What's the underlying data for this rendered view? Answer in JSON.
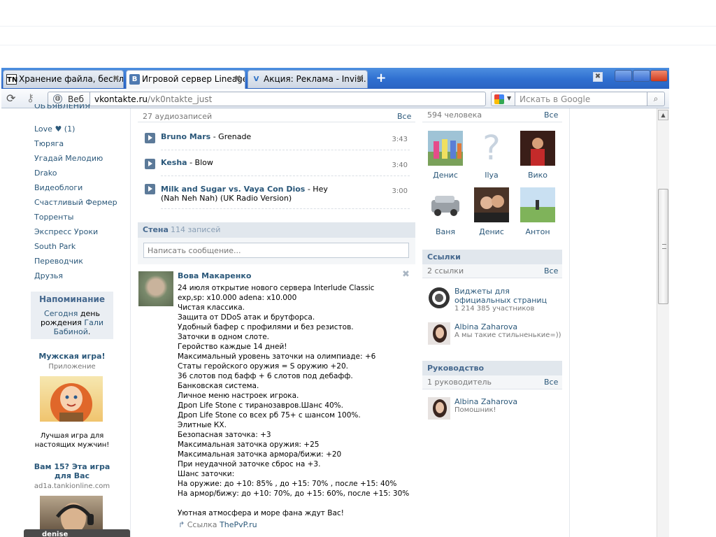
{
  "browser": {
    "tabs": [
      {
        "label": "Хранение файла, беспл...",
        "favicon": "TN"
      },
      {
        "label": "Игровой сервер Lineage...",
        "favicon": "B"
      },
      {
        "label": "Акция: Реклама - Invisi...",
        "favicon": "V"
      }
    ],
    "identity_label": "Веб",
    "url_host": "vkontakte.ru",
    "url_path": "/vk0ntakte_just",
    "search_placeholder": "Искать в Google",
    "icons": {
      "reload": "reload-icon",
      "key": "key-icon",
      "globe": "globe-icon",
      "search": "magnifier-icon",
      "new_tab": "plus-icon"
    }
  },
  "left_menu": {
    "partial_top": "ОБЪЯВЛЕНИЯ",
    "items": [
      "Love ♥ (1)",
      "Тюряга",
      "Угадай Мелодию",
      "Drako",
      "Видеоблоги",
      "Счастливый Фермер",
      "Торренты",
      "Экспресс Уроки",
      "South Park",
      "Переводчик",
      "Друзья"
    ]
  },
  "reminder": {
    "title": "Напоминание",
    "today": "Сегодня",
    "text": "день рождения",
    "name": "Гали Бабиной",
    "dot": "."
  },
  "ads": [
    {
      "title": "Мужская игра!",
      "sub": "Приложение",
      "text": "Лучшая игра для настоящих мужчин!"
    },
    {
      "title": "Вам 15? Эта игра для Вас",
      "sub": "ad1a.tankionline.com"
    }
  ],
  "tooltip_text": "denise",
  "audio": {
    "count": "27 аудиозаписей",
    "all": "Все",
    "tracks": [
      {
        "artist": "Bruno Mars",
        "title": " - Grenade",
        "duration": "3:43"
      },
      {
        "artist": "Kesha",
        "title": " - Blow",
        "duration": "3:40"
      },
      {
        "artist": "Milk and Sugar vs. Vaya Con Dios",
        "title": " - Hey (Nah Neh Nah) (UK Radio Version)",
        "duration": "3:00"
      }
    ]
  },
  "wall": {
    "title": "Стена",
    "count": "114 записей",
    "input_placeholder": "Написать сообщение...",
    "post": {
      "author": "Вова Макаренко",
      "lines": [
        "24 июля открытие нового сервера Interlude Classic",
        "exp,sp: x10.000 adena: x10.000",
        "Чистая классика.",
        "Защита от DDoS атак и брутфорса.",
        "Удобный бафер с профилями и без резистов.",
        "Заточки в одном слоте.",
        "Геройство каждые 14 дней!",
        "Максимальный уровень заточки на олимпиаде: +6",
        "Статы геройского оружия = S оружию +20.",
        "36 слотов под бафф + 6 слотов под дебафф.",
        "Банковская система.",
        "Личное меню настроек игрока.",
        "Дроп Life Stone с тиранозавров.Шанс 40%.",
        "Дроп Life Stone со всех рб 75+ с шансом 100%.",
        "Элитные КХ.",
        "Безопасная заточка: +3",
        "Максимальная заточка оружия: +25",
        "Максимальная заточка армора/бижи: +20",
        "При неудачной заточке сброс на +3.",
        "Шанс заточки:",
        "На оружие: до +10: 85% , до +15: 70% , после +15: 40%",
        "На армор/бижу: до +10: 70%, до +15: 60%, после +15: 30%",
        "",
        "Уютная атмосфера и море фана ждут Вас!"
      ],
      "link_label": "Ссылка",
      "link_text": "ThePvP.ru"
    }
  },
  "friends": {
    "count": "594 человека",
    "all": "Все",
    "people": [
      {
        "name": "Денис",
        "color": "#8fb4c8"
      },
      {
        "name": "Ilya",
        "color": "#ffffff"
      },
      {
        "name": "Вико",
        "color": "#5a2a22"
      },
      {
        "name": "Ваня",
        "color": "#b9bcc0"
      },
      {
        "name": "Денис",
        "color": "#6b4a3a"
      },
      {
        "name": "Антон",
        "color": "#8dbb6a"
      }
    ]
  },
  "links": {
    "title": "Ссылки",
    "count": "2 ссылки",
    "all": "Все",
    "items": [
      {
        "title": "Виджеты для официальных страниц",
        "sub": "1 214 385 участников"
      },
      {
        "title": "Albina Zaharova",
        "sub": "А мы такие стильненькие=))"
      }
    ]
  },
  "management": {
    "title": "Руководство",
    "count": "1 руководитель",
    "all": "Все",
    "items": [
      {
        "title": "Albina Zaharova",
        "sub": "Помошник!"
      }
    ]
  }
}
